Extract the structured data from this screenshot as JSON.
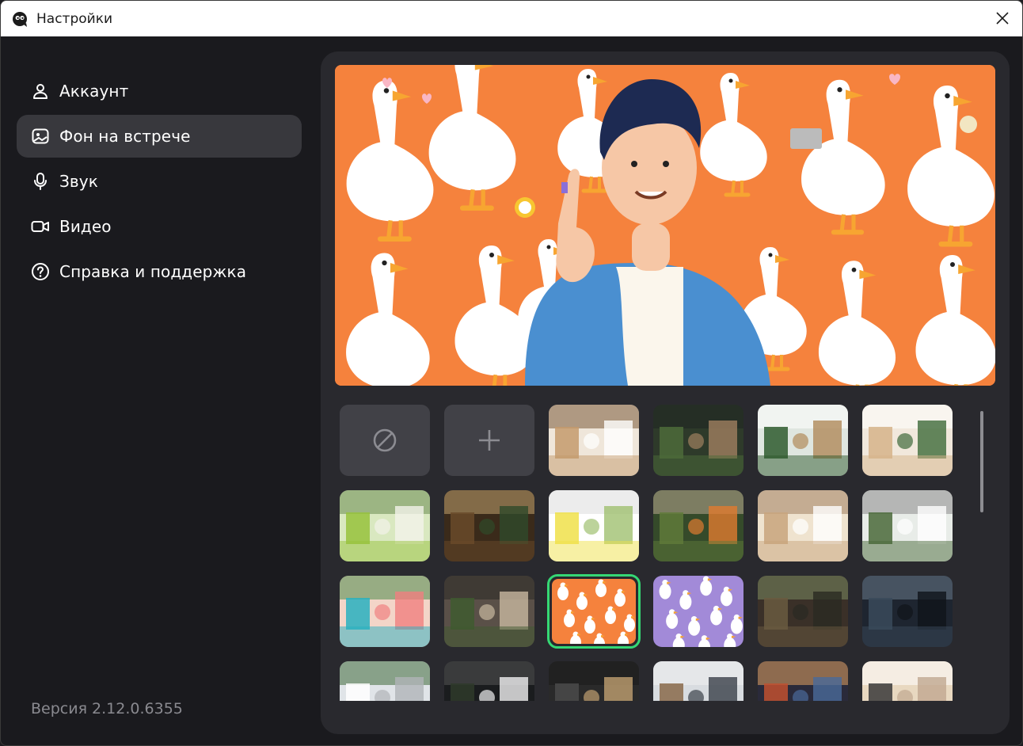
{
  "window": {
    "title": "Настройки"
  },
  "sidebar": {
    "items": [
      {
        "label": "Аккаунт",
        "icon": "user-icon",
        "active": false
      },
      {
        "label": "Фон на встрече",
        "icon": "image-icon",
        "active": true
      },
      {
        "label": "Звук",
        "icon": "microphone-icon",
        "active": false
      },
      {
        "label": "Видео",
        "icon": "camera-icon",
        "active": false
      },
      {
        "label": "Справка и поддержка",
        "icon": "help-icon",
        "active": false
      }
    ],
    "version": "Версия 2.12.0.6355"
  },
  "background_grid": {
    "controls": [
      {
        "icon": "no-background-icon"
      },
      {
        "icon": "plus-icon"
      }
    ],
    "selected_index": 14,
    "accent_color": "#35d874"
  },
  "colors": {
    "preview_orange": "#f5823d",
    "panel": "#29292e",
    "active_nav": "#38383d"
  }
}
